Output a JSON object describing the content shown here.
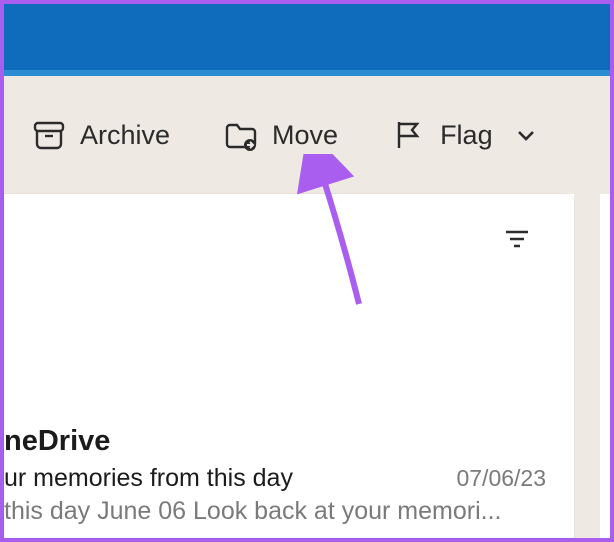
{
  "toolbar": {
    "archive_label": "Archive",
    "move_label": "Move",
    "flag_label": "Flag"
  },
  "message": {
    "sender": "neDrive",
    "subject": "ur memories from this day",
    "date": "07/06/23",
    "preview": " this day June 06 Look back at your memori..."
  }
}
